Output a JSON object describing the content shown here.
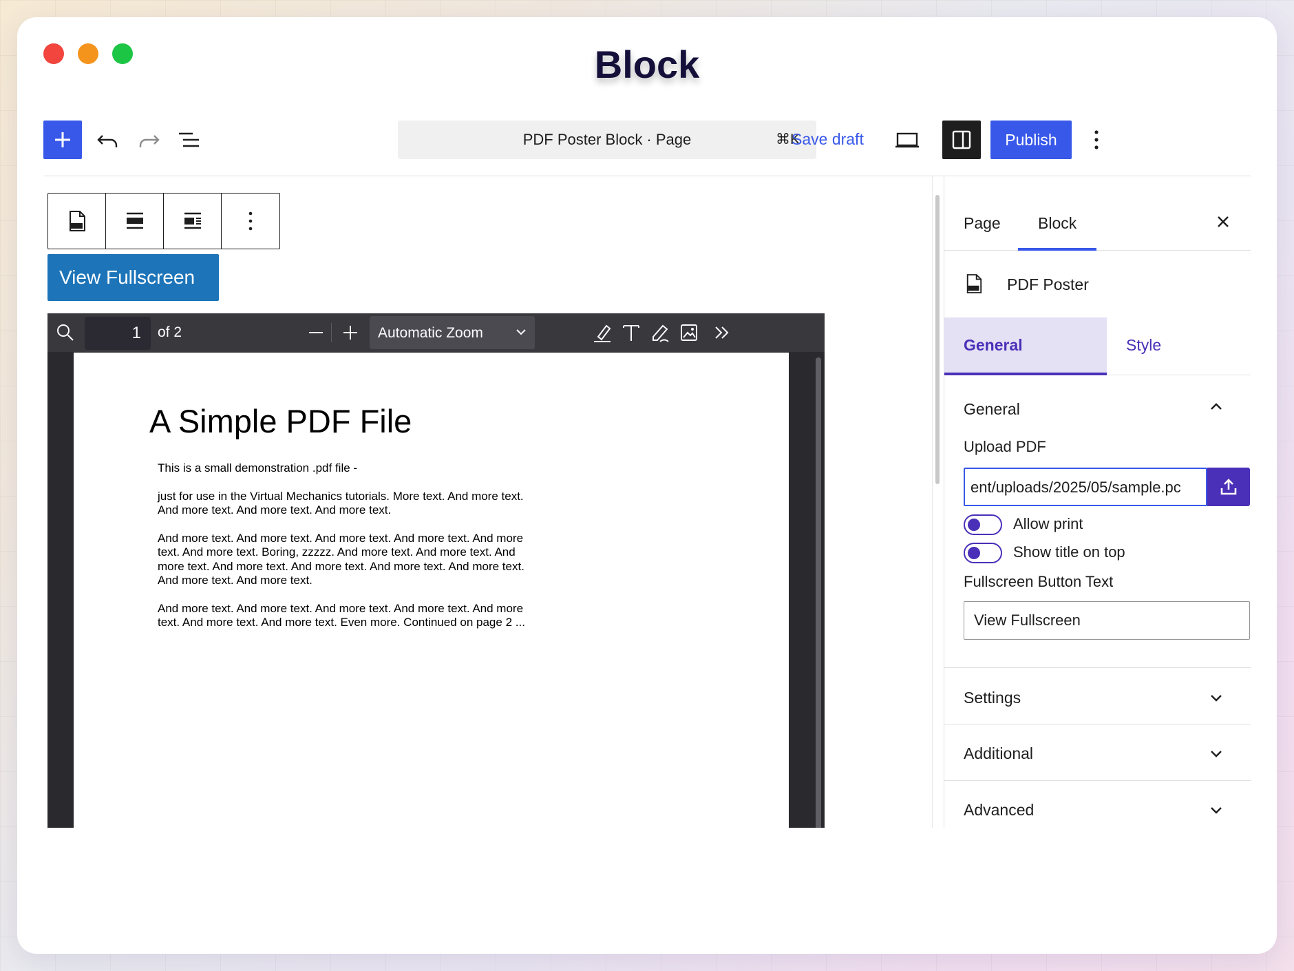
{
  "window": {
    "title": "Block"
  },
  "toolbar": {
    "command_bar_text": "PDF Poster Block · Page",
    "command_shortcut": "⌘K",
    "save_draft_label": "Save draft",
    "publish_label": "Publish"
  },
  "block": {
    "fullscreen_button": "View Fullscreen"
  },
  "pdf_viewer": {
    "page_number": "1",
    "page_of": "of 2",
    "zoom": "Automatic Zoom",
    "document": {
      "title": "A Simple PDF File",
      "paragraphs": [
        "This is a small demonstration .pdf file -",
        "just for use in the Virtual Mechanics tutorials. More text. And more text. And more text. And more text. And more text.",
        "And more text. And more text. And more text. And more text. And more text. And more text. Boring, zzzzz. And more text. And more text. And more text. And more text. And more text. And more text. And more text. And more text. And more text.",
        "And more text. And more text. And more text. And more text. And more text. And more text. And more text. Even more. Continued on page 2 ..."
      ]
    }
  },
  "sidebar": {
    "tabs": [
      "Page",
      "Block"
    ],
    "active_tab": "Block",
    "block_name": "PDF Poster",
    "settings_tabs": [
      "General",
      "Style"
    ],
    "general_panel": {
      "title": "General",
      "upload_label": "Upload PDF",
      "upload_value": "ent/uploads/2025/05/sample.pc",
      "allow_print_label": "Allow print",
      "show_title_label": "Show title on top",
      "fullscreen_text_label": "Fullscreen Button Text",
      "fullscreen_text_value": "View Fullscreen"
    },
    "panels": [
      "Settings",
      "Additional",
      "Advanced"
    ]
  },
  "colors": {
    "wp_blue": "#3858e9",
    "accent_purple": "#4a2fb8",
    "fullscreen_blue": "#1d74b8"
  }
}
